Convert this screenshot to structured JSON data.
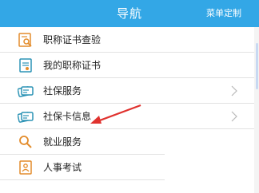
{
  "header": {
    "title": "导航",
    "action_label": "菜单定制"
  },
  "menu": {
    "items": [
      {
        "label": "职称证书查验",
        "icon": "certificate-check-icon",
        "has_chevron": false
      },
      {
        "label": "我的职称证书",
        "icon": "certificate-icon",
        "has_chevron": false
      },
      {
        "label": "社保服务",
        "icon": "social-security-card-icon",
        "has_chevron": true
      },
      {
        "label": "社保卡信息",
        "icon": "social-security-card-info-icon",
        "has_chevron": true
      },
      {
        "label": "就业服务",
        "icon": "employment-icon",
        "has_chevron": false
      },
      {
        "label": "人事考试",
        "icon": "exam-icon",
        "has_chevron": false
      }
    ]
  },
  "colors": {
    "header_background": "#33a7e6",
    "icon_orange": "#e38c2b",
    "icon_teal": "#2c93b5",
    "annotation_red": "#e0322e"
  }
}
